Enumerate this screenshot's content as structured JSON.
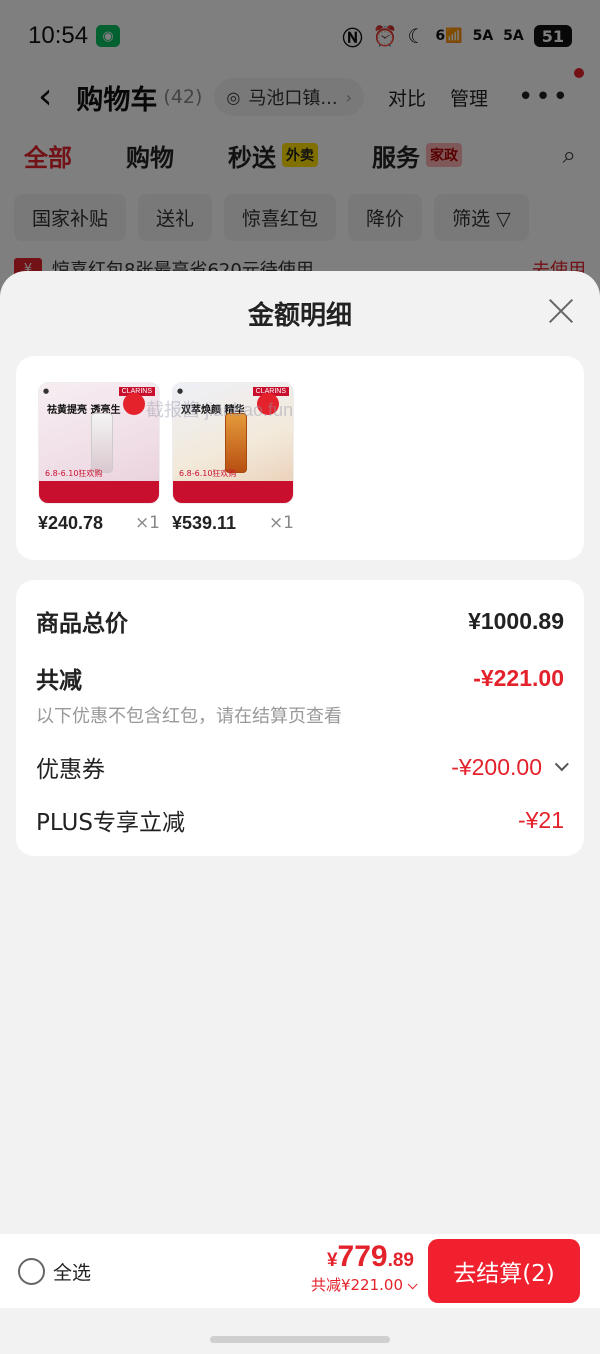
{
  "status_bar": {
    "time": "10:54",
    "signal_1": "5A",
    "signal_2": "5A",
    "wifi_label": "6",
    "battery": "51"
  },
  "cart_header": {
    "title": "购物车",
    "count": "(42)",
    "location": "马池口镇...",
    "compare": "对比",
    "manage": "管理",
    "more": "•••"
  },
  "tabs": [
    {
      "label": "全部"
    },
    {
      "label": "购物"
    },
    {
      "label": "秒送",
      "badge": "外卖"
    },
    {
      "label": "服务",
      "badge": "家政"
    }
  ],
  "filters": [
    "国家补贴",
    "送礼",
    "惊喜红包",
    "降价",
    "筛选"
  ],
  "redpack_strip": {
    "text": "惊喜红包8张最高省620元待使用",
    "action": "去使用"
  },
  "sheet": {
    "title": "金额明细",
    "watermark": "截报酱 jianbao.fun",
    "products": [
      {
        "price": "¥240.78",
        "qty": "×1",
        "headline": "祛黄提亮 透亮生",
        "promo": "6.8-6.10狂欢购",
        "brand": "CLARINS"
      },
      {
        "price": "¥539.11",
        "qty": "×1",
        "headline": "双萃焕颜 精华",
        "promo": "6.8-6.10狂欢购",
        "brand": "CLARINS"
      }
    ],
    "summary": {
      "total_label": "商品总价",
      "total_value": "¥1000.89",
      "discount_label": "共减",
      "discount_value": "-¥221.00",
      "discount_note": "以下优惠不包含红包，请在结算页查看",
      "coupon_label": "优惠券",
      "coupon_value": "-¥200.00",
      "plus_label": "PLUS专享立减",
      "plus_value": "-¥21"
    }
  },
  "checkout": {
    "select_all": "全选",
    "currency": "¥",
    "price_int": "779",
    "price_dec": ".89",
    "saved": "共减¥221.00",
    "button": "去结算(2)"
  }
}
